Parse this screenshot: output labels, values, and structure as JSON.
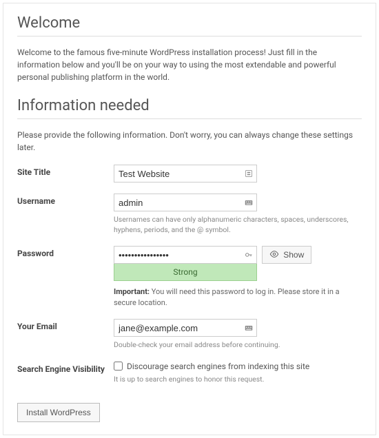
{
  "headings": {
    "welcome": "Welcome",
    "info": "Information needed"
  },
  "intro": {
    "welcome_text": "Welcome to the famous five-minute WordPress installation process! Just fill in the information below and you'll be on your way to using the most extendable and powerful personal publishing platform in the world.",
    "info_text": "Please provide the following information. Don't worry, you can always change these settings later."
  },
  "fields": {
    "site_title": {
      "label": "Site Title",
      "value": "Test Website"
    },
    "username": {
      "label": "Username",
      "value": "admin",
      "desc": "Usernames can have only alphanumeric characters, spaces, underscores, hyphens, periods, and the @ symbol."
    },
    "password": {
      "label": "Password",
      "value": "••••••••••••••••",
      "show_label": "Show",
      "strength": "Strong",
      "imp_label": "Important:",
      "imp_text": " You will need this password to log in. Please store it in a secure location."
    },
    "email": {
      "label": "Your Email",
      "value": "jane@example.com",
      "desc": "Double-check your email address before continuing."
    },
    "sev": {
      "label": "Search Engine Visibility",
      "checkbox_label": "Discourage search engines from indexing this site",
      "desc": "It is up to search engines to honor this request."
    }
  },
  "buttons": {
    "install": "Install WordPress"
  }
}
